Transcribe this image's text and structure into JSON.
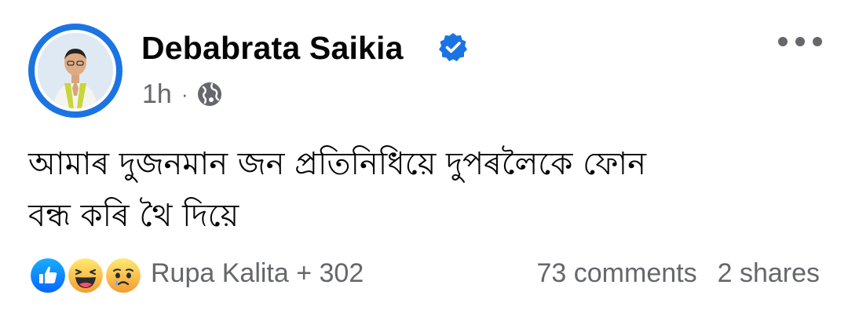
{
  "post": {
    "author": "Debabrata Saikia",
    "time": "1h",
    "separator": "·",
    "text_line1": "আমাৰ দুজনমান জন প্ৰতিনিধিয়ে দুপৰলৈকে ফোন",
    "text_line2": "বন্ধ কৰি থৈ দিয়ে",
    "reactors": "Rupa Kalita + 302",
    "comments": "73 comments",
    "shares": "2 shares"
  },
  "icons": {
    "verified": "verified-badge-icon",
    "audience": "globe-icon",
    "more": "more-options-icon",
    "reactions": [
      "like-reaction-icon",
      "haha-reaction-icon",
      "sad-reaction-icon"
    ]
  },
  "colors": {
    "brand_blue": "#1b74e4",
    "secondary_text": "#65676b",
    "primary_text": "#050505"
  }
}
